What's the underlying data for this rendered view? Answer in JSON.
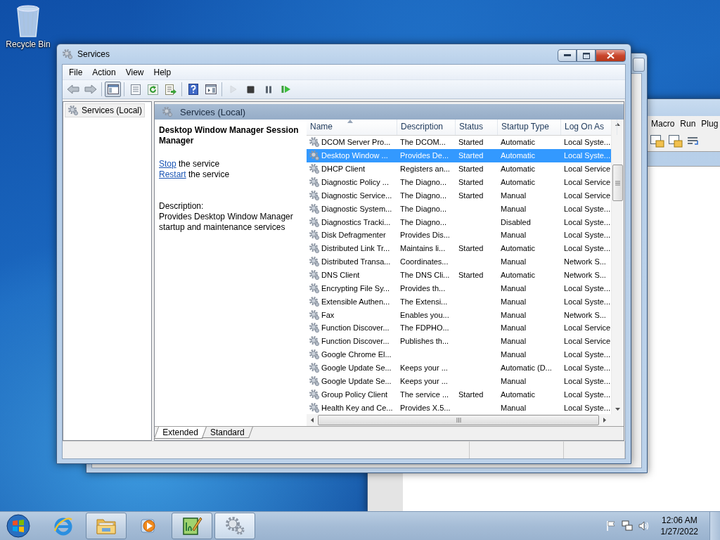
{
  "desktop": {
    "icons": [
      {
        "label": "Recycle Bin"
      }
    ]
  },
  "background_window": {
    "menu": [
      "Macro",
      "Run",
      "Plug"
    ]
  },
  "window": {
    "title": "Services",
    "menu": [
      "File",
      "Action",
      "View",
      "Help"
    ],
    "toolbar": {
      "groups": [
        {
          "buttons": [
            {
              "kind": "back",
              "disabled": false,
              "selected": false
            },
            {
              "kind": "forward",
              "disabled": false,
              "selected": false
            }
          ]
        },
        {
          "buttons": [
            {
              "kind": "console-tree",
              "disabled": false,
              "selected": true
            }
          ]
        },
        {
          "buttons": [
            {
              "kind": "properties",
              "disabled": false,
              "selected": false
            },
            {
              "kind": "refresh",
              "disabled": false,
              "selected": false
            },
            {
              "kind": "export",
              "disabled": false,
              "selected": false
            }
          ]
        },
        {
          "buttons": [
            {
              "kind": "help",
              "disabled": false,
              "selected": false
            },
            {
              "kind": "action-pane",
              "disabled": false,
              "selected": false
            }
          ]
        },
        {
          "buttons": [
            {
              "kind": "start",
              "disabled": true,
              "selected": false
            },
            {
              "kind": "stop",
              "disabled": false,
              "selected": false
            },
            {
              "kind": "pause",
              "disabled": false,
              "selected": false
            },
            {
              "kind": "resume",
              "disabled": false,
              "selected": false
            }
          ]
        }
      ]
    },
    "tree": {
      "items": [
        {
          "label": "Services (Local)",
          "selected": true
        }
      ]
    },
    "pane_header": "Services (Local)",
    "details": {
      "title": "Desktop Window Manager Session Manager",
      "actions": [
        {
          "link": "Stop",
          "text": "the service"
        },
        {
          "link": "Restart",
          "text": "the service"
        }
      ],
      "description_label": "Description:",
      "description": "Provides Desktop Window Manager startup and maintenance services"
    },
    "table": {
      "columns": [
        {
          "label": "Name",
          "sorted": true
        },
        {
          "label": "Description",
          "sorted": false
        },
        {
          "label": "Status",
          "sorted": false
        },
        {
          "label": "Startup Type",
          "sorted": false
        },
        {
          "label": "Log On As",
          "sorted": false
        }
      ],
      "rows": [
        {
          "cells": [
            "DCOM Server Pro...",
            "The DCOM...",
            "Started",
            "Automatic",
            "Local Syste..."
          ],
          "selected": false
        },
        {
          "cells": [
            "Desktop Window ...",
            "Provides De...",
            "Started",
            "Automatic",
            "Local Syste..."
          ],
          "selected": true
        },
        {
          "cells": [
            "DHCP Client",
            "Registers an...",
            "Started",
            "Automatic",
            "Local Service"
          ],
          "selected": false
        },
        {
          "cells": [
            "Diagnostic Policy ...",
            "The Diagno...",
            "Started",
            "Automatic",
            "Local Service"
          ],
          "selected": false
        },
        {
          "cells": [
            "Diagnostic Service...",
            "The Diagno...",
            "Started",
            "Manual",
            "Local Service"
          ],
          "selected": false
        },
        {
          "cells": [
            "Diagnostic System...",
            "The Diagno...",
            "",
            "Manual",
            "Local Syste..."
          ],
          "selected": false
        },
        {
          "cells": [
            "Diagnostics Tracki...",
            "The Diagno...",
            "",
            "Disabled",
            "Local Syste..."
          ],
          "selected": false
        },
        {
          "cells": [
            "Disk Defragmenter",
            "Provides Dis...",
            "",
            "Manual",
            "Local Syste..."
          ],
          "selected": false
        },
        {
          "cells": [
            "Distributed Link Tr...",
            "Maintains li...",
            "Started",
            "Automatic",
            "Local Syste..."
          ],
          "selected": false
        },
        {
          "cells": [
            "Distributed Transa...",
            "Coordinates...",
            "",
            "Manual",
            "Network S..."
          ],
          "selected": false
        },
        {
          "cells": [
            "DNS Client",
            "The DNS Cli...",
            "Started",
            "Automatic",
            "Network S..."
          ],
          "selected": false
        },
        {
          "cells": [
            "Encrypting File Sy...",
            "Provides th...",
            "",
            "Manual",
            "Local Syste..."
          ],
          "selected": false
        },
        {
          "cells": [
            "Extensible Authen...",
            "The Extensi...",
            "",
            "Manual",
            "Local Syste..."
          ],
          "selected": false
        },
        {
          "cells": [
            "Fax",
            "Enables you...",
            "",
            "Manual",
            "Network S..."
          ],
          "selected": false
        },
        {
          "cells": [
            "Function Discover...",
            "The FDPHO...",
            "",
            "Manual",
            "Local Service"
          ],
          "selected": false
        },
        {
          "cells": [
            "Function Discover...",
            "Publishes th...",
            "",
            "Manual",
            "Local Service"
          ],
          "selected": false
        },
        {
          "cells": [
            "Google Chrome El...",
            "",
            "",
            "Manual",
            "Local Syste..."
          ],
          "selected": false
        },
        {
          "cells": [
            "Google Update Se...",
            "Keeps your ...",
            "",
            "Automatic (D...",
            "Local Syste..."
          ],
          "selected": false
        },
        {
          "cells": [
            "Google Update Se...",
            "Keeps your ...",
            "",
            "Manual",
            "Local Syste..."
          ],
          "selected": false
        },
        {
          "cells": [
            "Group Policy Client",
            "The service ...",
            "Started",
            "Automatic",
            "Local Syste..."
          ],
          "selected": false
        },
        {
          "cells": [
            "Health Key and Ce...",
            "Provides X.5...",
            "",
            "Manual",
            "Local Syste..."
          ],
          "selected": false
        }
      ]
    },
    "tabs": [
      {
        "label": "Extended",
        "selected": true
      },
      {
        "label": "Standard",
        "selected": false
      }
    ]
  },
  "taskbar": {
    "items": [
      {
        "kind": "ie",
        "open": false,
        "selected": false
      },
      {
        "kind": "explorer",
        "open": true,
        "selected": false
      },
      {
        "kind": "media",
        "open": false,
        "selected": false
      },
      {
        "kind": "notepad",
        "open": true,
        "selected": false
      },
      {
        "kind": "services",
        "open": true,
        "selected": true
      }
    ],
    "clock": {
      "time": "12:06 AM",
      "date": "1/27/2022"
    }
  }
}
